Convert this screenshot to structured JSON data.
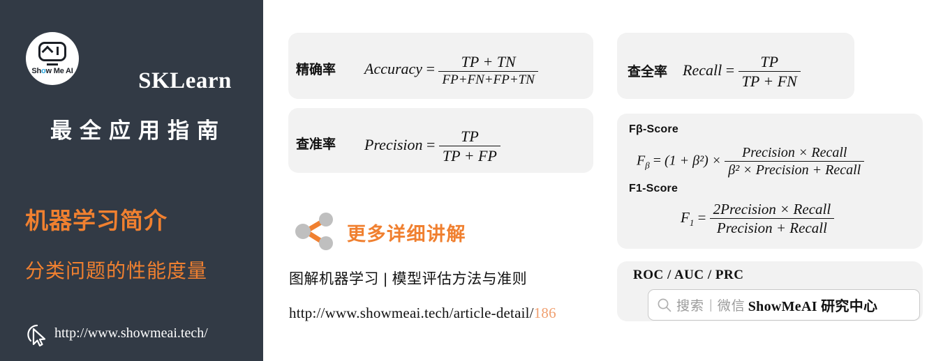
{
  "left_panel": {
    "logo": {
      "name": "show-me-ai-logo",
      "text": "Show Me AI"
    },
    "product_title": "SKLearn",
    "guide_title": "最全应用指南",
    "topic_title": "机器学习简介",
    "topic_subtitle": "分类问题的性能度量",
    "footer_url": "http://www.showmeai.tech/",
    "cursor_icon": "cursor-pointer-icon",
    "background_color": "#323a45",
    "accent_color": "#f08030"
  },
  "formulas": {
    "accuracy": {
      "label": "精确率",
      "name": "Accuracy",
      "equals": "=",
      "numerator": "TP + TN",
      "denominator": "FP+FN+FP+TN"
    },
    "precision": {
      "label": "查准率",
      "name": "Precision",
      "equals": "=",
      "numerator": "TP",
      "denominator": "TP + FP"
    },
    "recall": {
      "label": "查全率",
      "name": "Recall",
      "equals": "=",
      "numerator": "TP",
      "denominator": "TP + FN"
    },
    "fbeta": {
      "section_label": "Fβ-Score",
      "lhs": "F",
      "lhs_sub": "β",
      "equals": "=",
      "factor": "(1 + β²) ×",
      "numerator": "Precision × Recall",
      "denominator": "β² × Precision + Recall"
    },
    "f1": {
      "section_label": "F1-Score",
      "lhs": "F",
      "lhs_sub": "1",
      "equals": "=",
      "numerator": "2Precision × Recall",
      "denominator": "Precision + Recall"
    }
  },
  "roc_box": {
    "label": "ROC / AUC / PRC",
    "search": {
      "icon": "search-icon",
      "hint": "搜索",
      "separator": "|",
      "channel": "微信",
      "brand": "ShowMeAI 研究中心"
    }
  },
  "promo": {
    "share_icon": "share-nodes-icon",
    "more_text": "更多详细讲解",
    "article_title": "图解机器学习 | 模型评估方法与准则",
    "article_url_base": "http://www.showmeai.tech/article-detail/",
    "article_url_id": "186"
  },
  "watermark": {
    "text": "ShowMeAI",
    "colors": [
      "#e98060",
      "#c89aa8",
      "#9f93b8",
      "#4fb3c8"
    ]
  }
}
